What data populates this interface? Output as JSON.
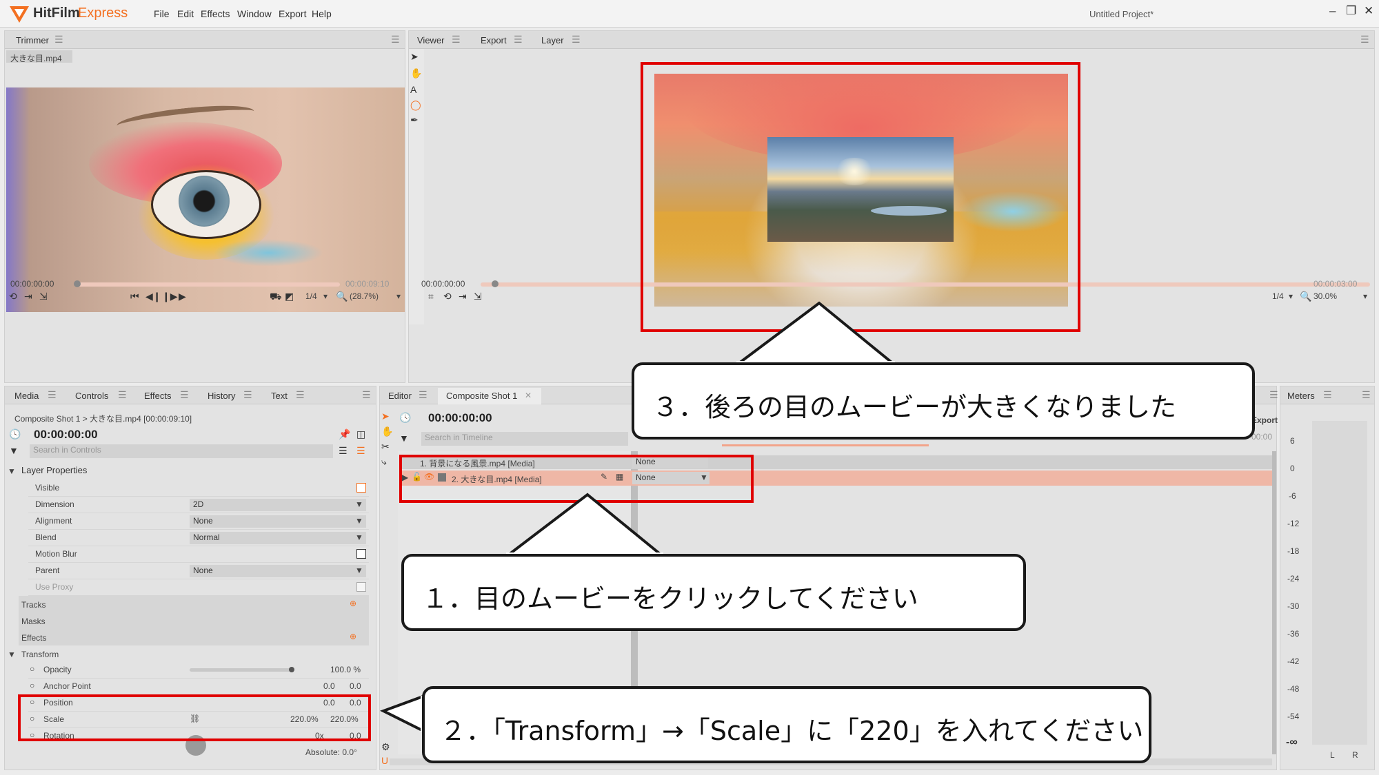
{
  "app": {
    "name_part1": "HitFilm",
    "name_part2": "Express",
    "menu": [
      "File",
      "Edit",
      "Effects",
      "Window",
      "Export",
      "Help"
    ],
    "project_title": "Untitled Project*"
  },
  "trimmer": {
    "tab": "Trimmer",
    "file": "大きな目.mp4",
    "time_start": "00:00:00:00",
    "time_end": "00:00:09:10",
    "resolution": "1/4",
    "zoom": "(28.7%)"
  },
  "viewer": {
    "tabs": [
      "Viewer",
      "Export",
      "Layer"
    ],
    "time_start": "00:00:00:00",
    "time_end": "00:00:03:00",
    "resolution": "1/4",
    "zoom": "30.0%"
  },
  "controls": {
    "tabs": [
      "Media",
      "Controls",
      "Effects",
      "History",
      "Text"
    ],
    "breadcrumb": "Composite Shot 1 > 大きな目.mp4 [00:00:09:10]",
    "time": "00:00:00:00",
    "search_placeholder": "Search in Controls",
    "layer_properties": "Layer Properties",
    "props": [
      {
        "label": "Visible",
        "value": ""
      },
      {
        "label": "Dimension",
        "value": "2D"
      },
      {
        "label": "Alignment",
        "value": "None"
      },
      {
        "label": "Blend",
        "value": "Normal"
      },
      {
        "label": "Motion Blur",
        "value": ""
      },
      {
        "label": "Parent",
        "value": "None"
      },
      {
        "label": "Use Proxy",
        "value": ""
      }
    ],
    "sections": [
      "Tracks",
      "Masks",
      "Effects"
    ],
    "transform": "Transform",
    "transform_props": [
      {
        "label": "Opacity",
        "v1": "100.0 %",
        "v2": ""
      },
      {
        "label": "Anchor Point",
        "v1": "0.0",
        "v2": "0.0"
      },
      {
        "label": "Position",
        "v1": "0.0",
        "v2": "0.0"
      },
      {
        "label": "Scale",
        "v1": "220.0%",
        "v2": "220.0%"
      },
      {
        "label": "Rotation",
        "v1": "0x",
        "v2": "0.0"
      }
    ],
    "absolute": "Absolute: 0.0°"
  },
  "editor": {
    "tabs": [
      "Editor",
      "Composite Shot 1"
    ],
    "time": "00:00:00:00",
    "search_placeholder": "Search in Timeline",
    "export_label": "Export",
    "export_time": "00:00",
    "layers": [
      {
        "name": "1. 背景になる風景.mp4 [Media]",
        "blend": "None"
      },
      {
        "name": "2. 大きな目.mp4 [Media]",
        "blend": "None"
      }
    ]
  },
  "meters": {
    "tab": "Meters",
    "scale": [
      "6",
      "0",
      "-6",
      "-12",
      "-18",
      "-24",
      "-30",
      "-36",
      "-42",
      "-48",
      "-54",
      "-∞"
    ],
    "channels": [
      "L",
      "R"
    ]
  },
  "callouts": {
    "step1": "１．目のムービーをクリックしてください",
    "step2": "２．「Transform」→「Scale」に「220」を入れてください",
    "step3": "３．後ろの目のムービーが大きくなりました"
  },
  "colors": {
    "accent": "#f37021",
    "highlight": "#e00000",
    "selected_layer": "#efb7a6"
  }
}
